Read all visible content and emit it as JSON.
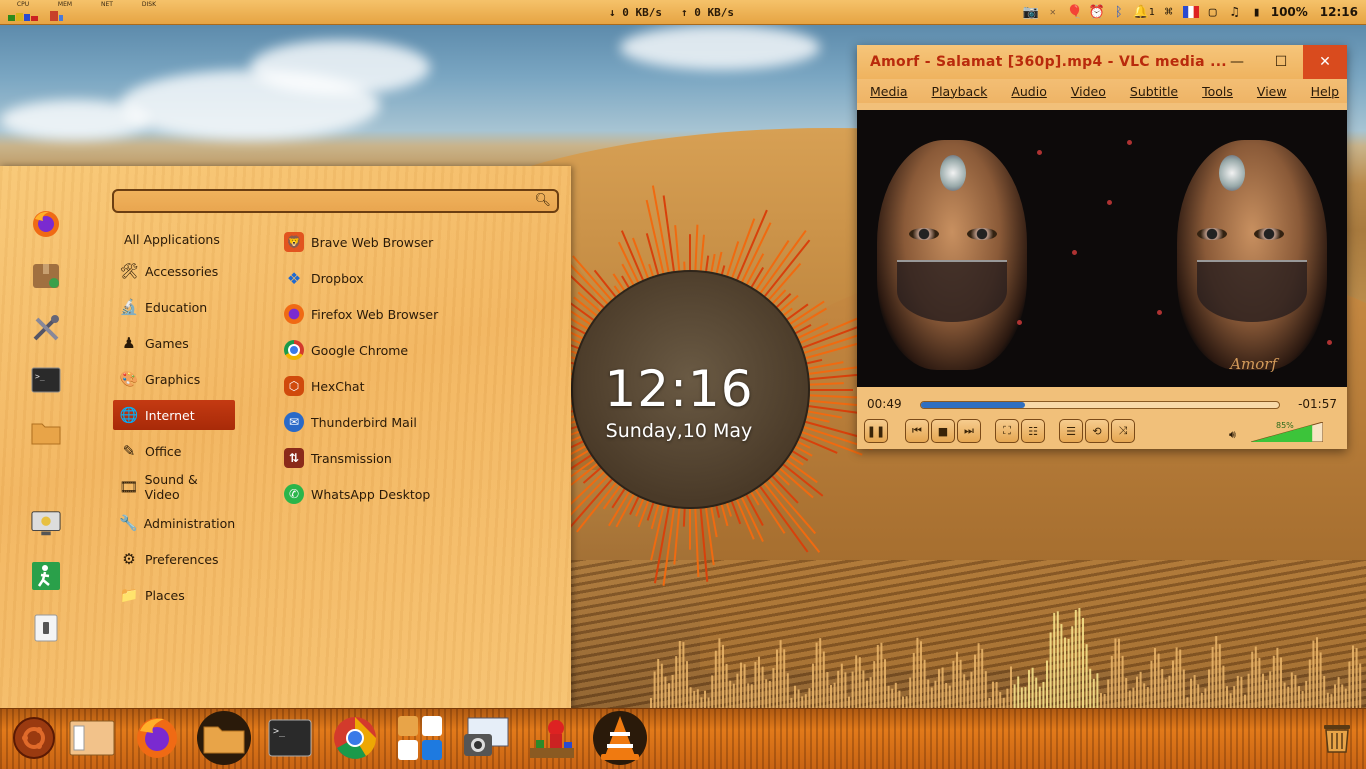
{
  "top_panel": {
    "monitors": [
      {
        "label": "CPU",
        "colors": [
          "#2e8a1a",
          "#d9b21a",
          "#2a4ad0",
          "#c22"
        ]
      },
      {
        "label": "MEM",
        "colors": [
          "#c8402a",
          "#4a7ad8"
        ]
      },
      {
        "label": "NET",
        "colors": [
          "#a06a22"
        ]
      },
      {
        "label": "DISK",
        "colors": [
          "#a06a22"
        ]
      }
    ],
    "download": "↓ 0 KB/s",
    "upload": "↑ 0 KB/s",
    "battery": "100%",
    "clock": "12:16"
  },
  "app_menu": {
    "search": {
      "placeholder": ""
    },
    "all_applications": "All Applications",
    "categories": [
      {
        "label": "Accessories"
      },
      {
        "label": "Education"
      },
      {
        "label": "Games"
      },
      {
        "label": "Graphics"
      },
      {
        "label": "Internet",
        "selected": true
      },
      {
        "label": "Office"
      },
      {
        "label": "Sound & Video"
      },
      {
        "label": "Administration"
      },
      {
        "label": "Preferences"
      },
      {
        "label": "Places"
      }
    ],
    "apps": [
      {
        "label": "Brave Web Browser",
        "color": "#e2541f",
        "icon": "brave-icon"
      },
      {
        "label": "Dropbox",
        "color": "#1e6ad2",
        "icon": "dropbox-icon"
      },
      {
        "label": "Firefox Web Browser",
        "color": "#f06a14",
        "icon": "firefox-icon"
      },
      {
        "label": "Google Chrome",
        "color": "#d33a2c",
        "icon": "chrome-icon"
      },
      {
        "label": "HexChat",
        "color": "#d04a0c",
        "icon": "hexchat-icon"
      },
      {
        "label": "Thunderbird Mail",
        "color": "#2a6ac8",
        "icon": "thunderbird-icon"
      },
      {
        "label": "Transmission",
        "color": "#8a2a1a",
        "icon": "transmission-icon"
      },
      {
        "label": "WhatsApp Desktop",
        "color": "#2ab54a",
        "icon": "whatsapp-icon"
      }
    ]
  },
  "desktop_clock": {
    "time": "12:16",
    "date": "Sunday,10 May"
  },
  "vlc": {
    "title": "Amorf - Salamat [360p].mp4 - VLC media ...",
    "menu": [
      "Media",
      "Playback",
      "Audio",
      "Video",
      "Subtitle",
      "Tools",
      "View",
      "Help"
    ],
    "video_watermark": "Amorf",
    "elapsed": "00:49",
    "remaining": "-01:57",
    "progress": 0.29,
    "volume_label": "85%",
    "volume": 0.85
  },
  "dock": {
    "items": [
      "ubuntu-icon",
      "files-manager-icon",
      "firefox-icon",
      "folder-icon",
      "terminal-icon",
      "chrome-icon",
      "office-icon",
      "screenshot-icon",
      "game-icon",
      "vlc-icon",
      "trash-icon"
    ]
  }
}
